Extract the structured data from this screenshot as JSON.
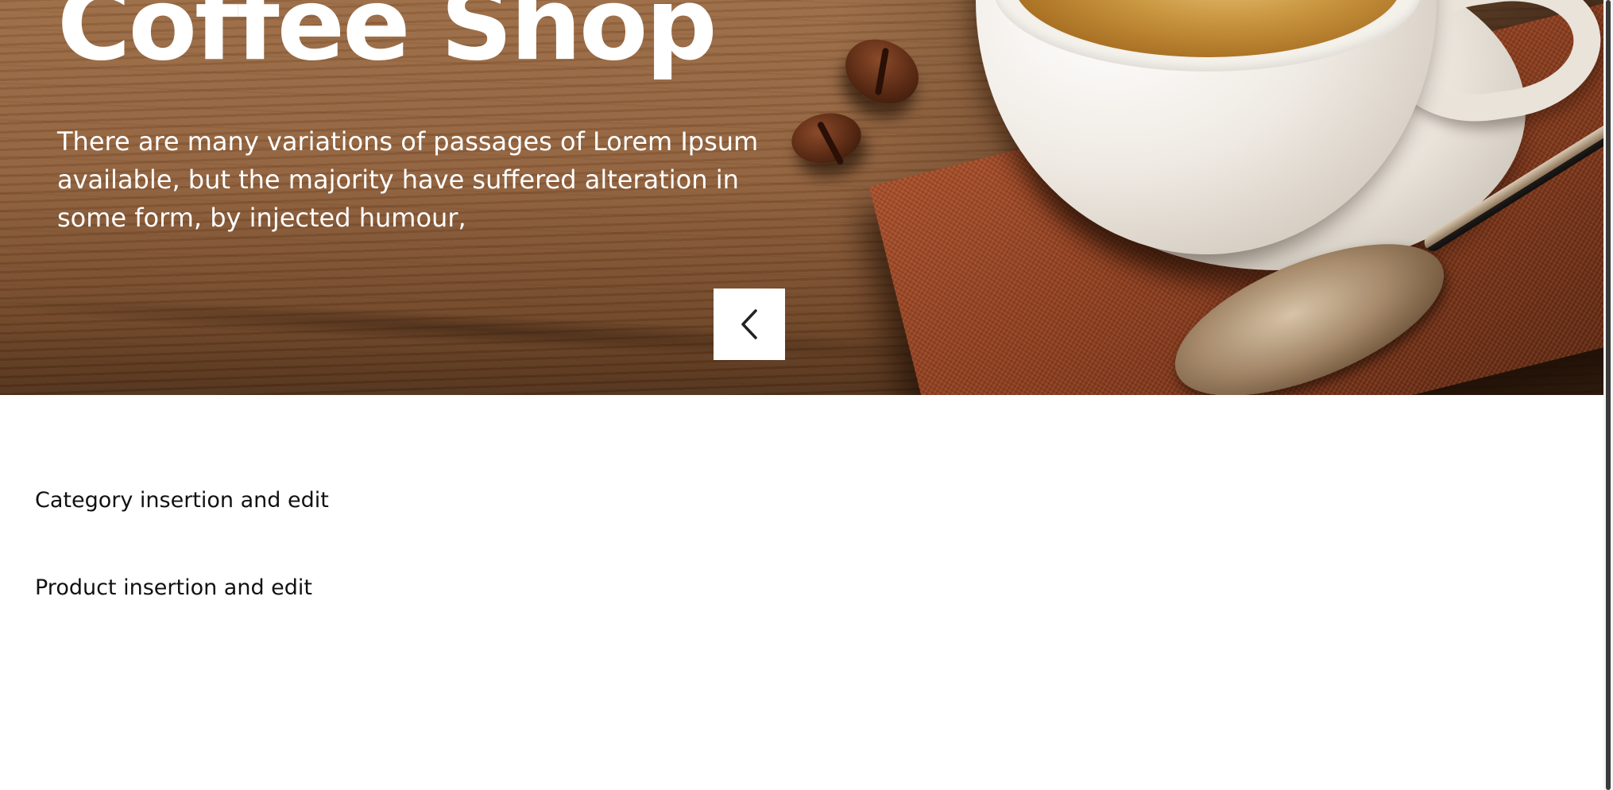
{
  "hero": {
    "title": "Coffee Shop",
    "description": "There are many variations of passages of Lorem Ipsum available, but the majority have suffered alteration in some form, by injected humour,",
    "prev_icon": "chevron-left-icon"
  },
  "links": {
    "category": "Category insertion and edit",
    "product": "Product insertion and edit"
  },
  "colors": {
    "hero_text": "#ffffff",
    "link_text": "#111111",
    "page_background": "#ffffff"
  }
}
